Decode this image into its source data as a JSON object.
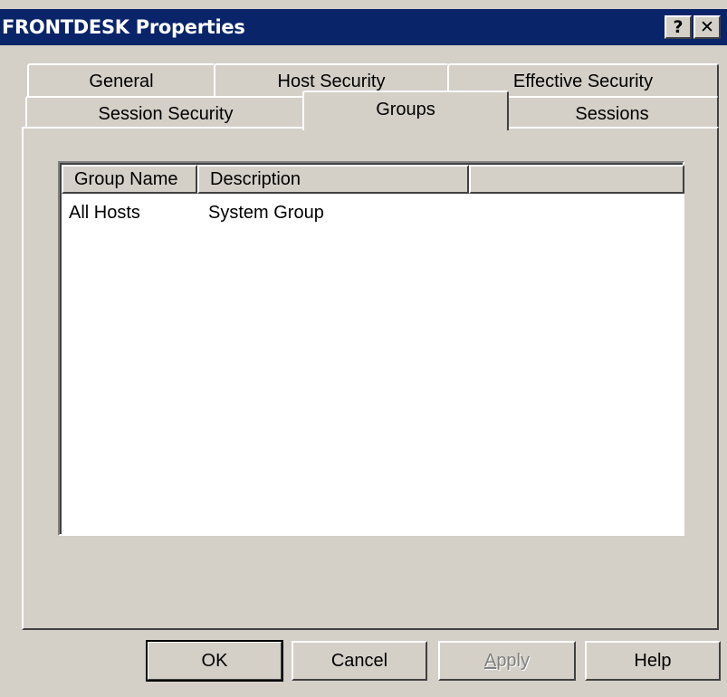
{
  "window": {
    "title": "FRONTDESK Properties",
    "help_label": "?",
    "close_label": "✕",
    "colors": {
      "titlebar": "#0a246a",
      "face": "#d4d0c8"
    }
  },
  "tabs": {
    "row1": [
      "General",
      "Host Security",
      "Effective Security"
    ],
    "row2": [
      "Session Security",
      "Groups",
      "Sessions"
    ],
    "active": "Groups"
  },
  "groups_list": {
    "columns": [
      "Group Name",
      "Description",
      ""
    ],
    "rows": [
      {
        "name": "All Hosts",
        "description": "System Group"
      }
    ]
  },
  "buttons": {
    "ok": "OK",
    "cancel": "Cancel",
    "apply_first": "A",
    "apply_rest": "pply",
    "help": "Help"
  }
}
